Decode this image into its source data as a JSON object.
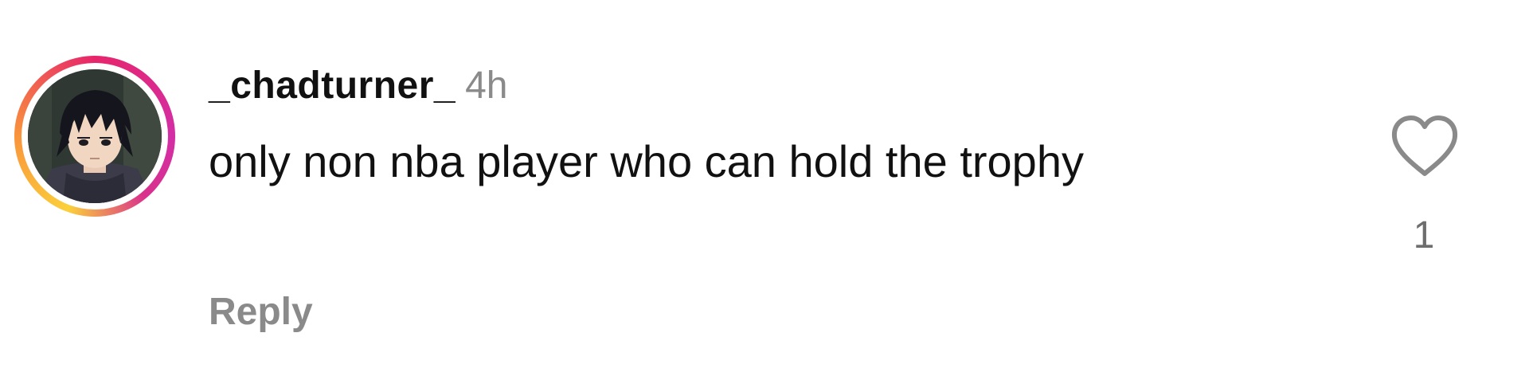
{
  "comment": {
    "username": "_chadturner_",
    "timestamp": "4h",
    "text": "only non nba player who can hold the trophy",
    "reply_label": "Reply",
    "like_count": "1",
    "icons": {
      "avatar": "profile-picture",
      "like": "heart-outline-icon"
    },
    "colors": {
      "ring_start": "#fbd03b",
      "ring_end": "#d32ea6",
      "meta_gray": "#8a8a8a"
    }
  }
}
